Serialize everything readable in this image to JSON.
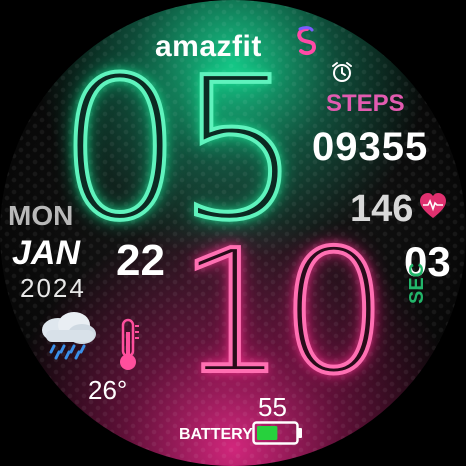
{
  "brand": {
    "name": "amazfit"
  },
  "time": {
    "hour": "05",
    "minute": "10",
    "second": "03",
    "second_label": "SEC"
  },
  "date": {
    "weekday": "MON",
    "month": "JAN",
    "day": "22",
    "year": "2024"
  },
  "steps": {
    "label": "STEPS",
    "value": "09355"
  },
  "heart_rate": {
    "value": "146",
    "icon": "heart-icon"
  },
  "weather": {
    "temperature": "26°",
    "icon": "rain-cloud-icon",
    "temp_icon": "thermometer-icon"
  },
  "battery": {
    "label": "BATTERY",
    "value": "55",
    "level_percent": 55,
    "icon": "battery-icon"
  },
  "alarm": {
    "icon": "alarm-clock-icon"
  },
  "colors": {
    "green": "#5ff3bd",
    "pink": "#ff6fb2",
    "steps_label": "#e25bb0",
    "sec_label": "#22b56a"
  }
}
